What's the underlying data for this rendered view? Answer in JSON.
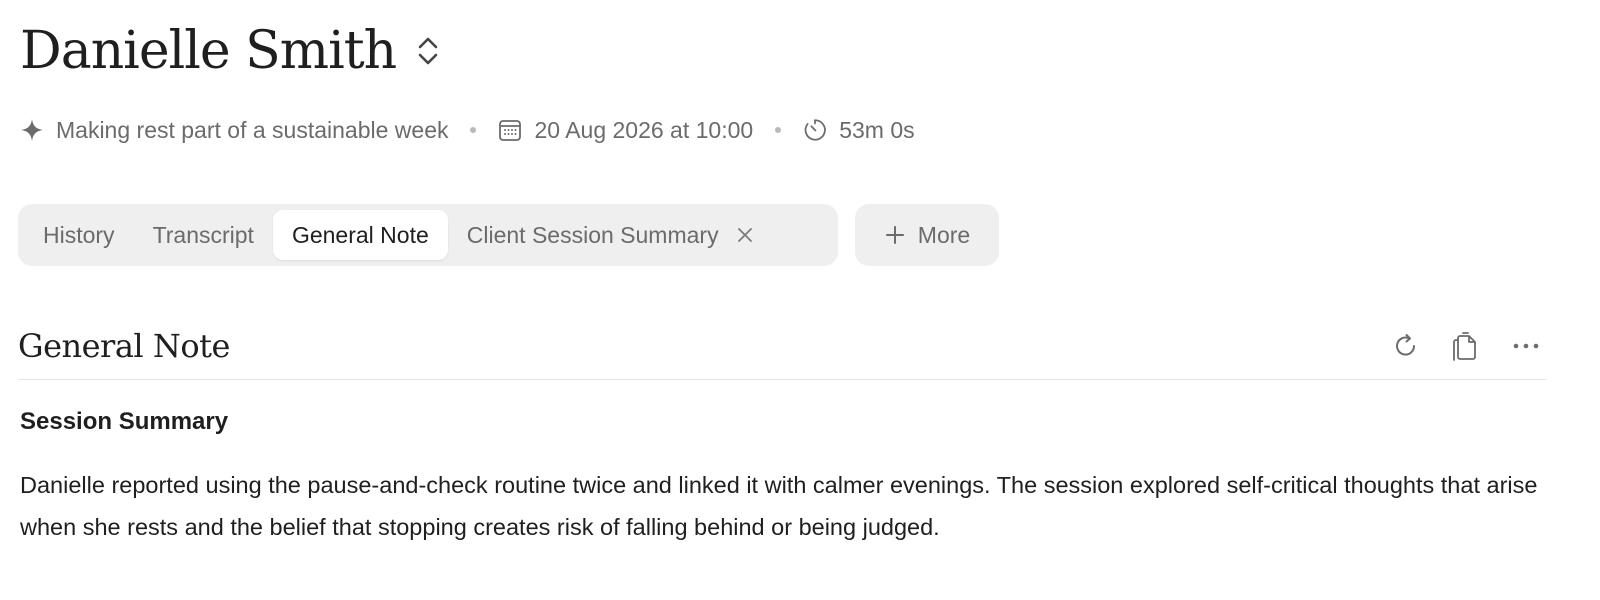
{
  "header": {
    "client_name": "Danielle Smith",
    "switch_icon": "chevron-up-down-icon"
  },
  "meta": {
    "topic": "Making rest part of a sustainable week",
    "topic_icon": "sparkle-icon",
    "date": "20 Aug 2026 at 10:00",
    "date_icon": "calendar-icon",
    "duration": "53m 0s",
    "duration_icon": "timer-icon"
  },
  "tabs": [
    {
      "label": "History",
      "active": false
    },
    {
      "label": "Transcript",
      "active": false
    },
    {
      "label": "General Note",
      "active": true
    },
    {
      "label": "Client Session Summary",
      "active": false,
      "closable": true
    }
  ],
  "more_button": {
    "label": "More",
    "icon": "plus-icon"
  },
  "section": {
    "title": "General Note",
    "actions": [
      "regenerate-icon",
      "copy-icon",
      "more-options-icon"
    ]
  },
  "note": {
    "heading": "Session Summary",
    "paragraph": "Danielle reported using the pause-and-check routine twice and linked it with calmer evenings. The session explored self-critical thoughts that arise when she rests and the belief that stopping creates risk of falling behind or being judged."
  },
  "colors": {
    "text_primary": "#1f1f1f",
    "text_muted": "#6b6b6b",
    "tab_bar_bg": "#efefef",
    "active_tab_bg": "#ffffff",
    "divider": "#e6e6e6"
  }
}
